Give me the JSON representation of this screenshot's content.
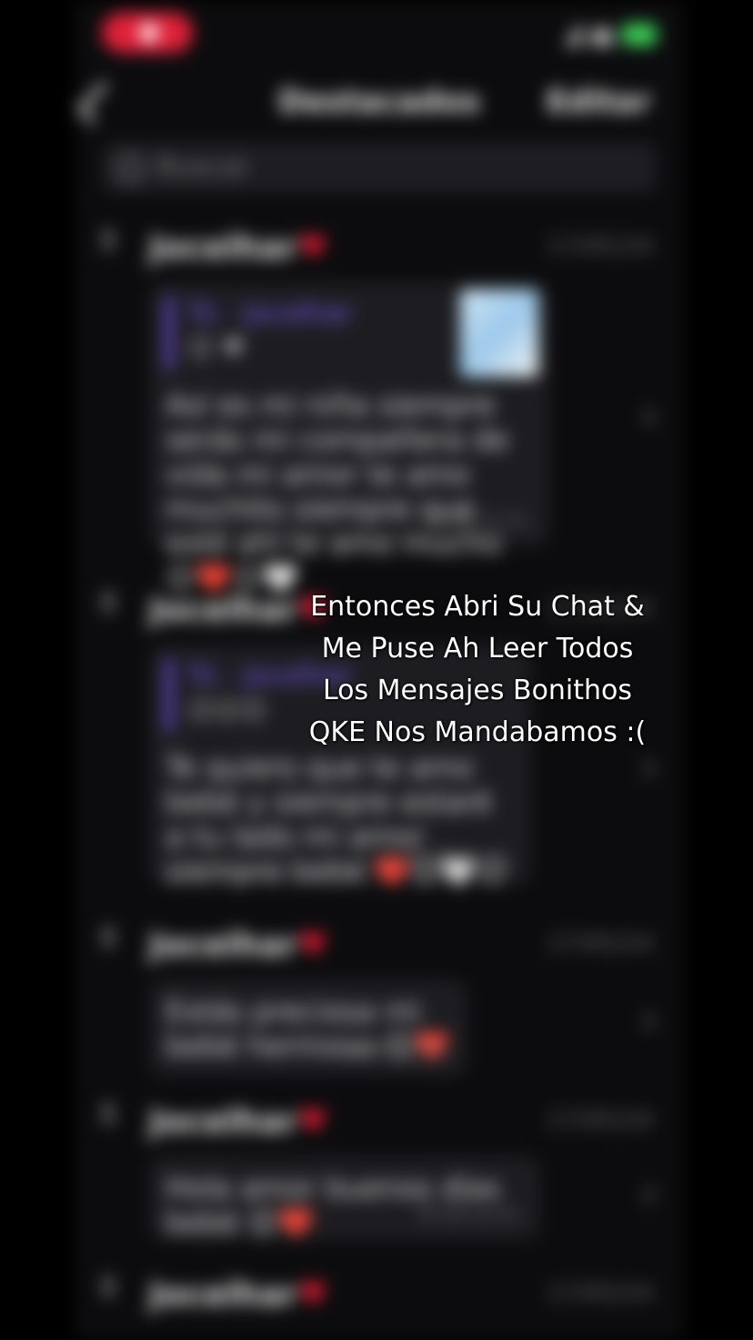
{
  "header": {
    "title": "Destacados",
    "edit_label": "Editar"
  },
  "search": {
    "placeholder": "Buscar"
  },
  "threads": [
    {
      "sender": "Jocelhar",
      "timestamp": "17/05/24",
      "reply": {
        "name": "Tú · Jocelhar",
        "preview": "😊 ♥"
      },
      "message": "Así es mi niña siempre serás mi compañera de vida mi amor te amo muchito siempre que esté ahí te amo mucho 😊❤️😊🤍",
      "time": "8:10 p.m."
    },
    {
      "sender": "Jocelhar",
      "timestamp": "17/05/24",
      "reply": {
        "name": "Tú · Jocelhar",
        "preview": "😊😊😊"
      },
      "message": "Te quiero que te amo bebé y siempre estaré a tu lado mi amor siempre bebé ❤️😊🤍😊",
      "time": "8:21 p.m."
    },
    {
      "sender": "Jocelhar",
      "timestamp": "17/05/24",
      "message": "Estás preciosa mi bebé hermosa 😊❤️",
      "time": "8:25 p.m."
    },
    {
      "sender": "Jocelhar",
      "timestamp": "17/05/24",
      "message": "Hola amor buenos días bebé 😊❤️",
      "time": "9:10 a.m."
    },
    {
      "sender": "Jocelhar",
      "timestamp": "17/05/24"
    }
  ],
  "caption": {
    "line1": "Entonces Abri Su Chat &",
    "line2": "Me Puse Ah Leer Todos",
    "line3": "Los Mensajes Bonithos",
    "line4": "QKE Nos Mandabamos :("
  }
}
